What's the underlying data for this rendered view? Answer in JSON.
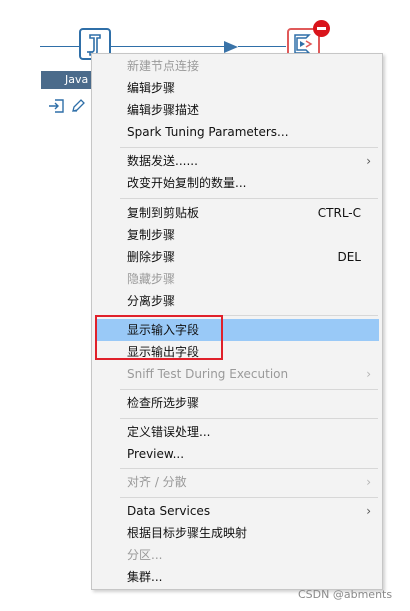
{
  "canvas": {
    "step_label": "Java"
  },
  "menu": {
    "items": [
      {
        "label": "新建节点连接",
        "disabled": true
      },
      {
        "label": "编辑步骤"
      },
      {
        "label": "编辑步骤描述"
      },
      {
        "label": "Spark Tuning Parameters..."
      },
      {
        "label": "数据发送......",
        "submenu": true
      },
      {
        "label": "改变开始复制的数量..."
      },
      {
        "label": "复制到剪贴板",
        "shortcut": "CTRL-C"
      },
      {
        "label": "复制步骤"
      },
      {
        "label": "删除步骤",
        "shortcut": "DEL"
      },
      {
        "label": "隐藏步骤",
        "disabled": true
      },
      {
        "label": "分离步骤"
      },
      {
        "label": "显示输入字段",
        "highlighted": true
      },
      {
        "label": "显示输出字段"
      },
      {
        "label": "Sniff Test During Execution",
        "disabled": true,
        "submenu": true
      },
      {
        "label": "检查所选步骤"
      },
      {
        "label": "定义错误处理..."
      },
      {
        "label": "Preview..."
      },
      {
        "label": "对齐 / 分散",
        "disabled": true,
        "submenu": true
      },
      {
        "label": "Data Services",
        "submenu": true
      },
      {
        "label": "根据目标步骤生成映射"
      },
      {
        "label": "分区...",
        "disabled": true
      },
      {
        "label": "集群..."
      }
    ],
    "submenu_glyph": "›",
    "highlight_color": "#99c9f7",
    "annotation_color": "#e0202a"
  },
  "watermark": "CSDN @abments"
}
